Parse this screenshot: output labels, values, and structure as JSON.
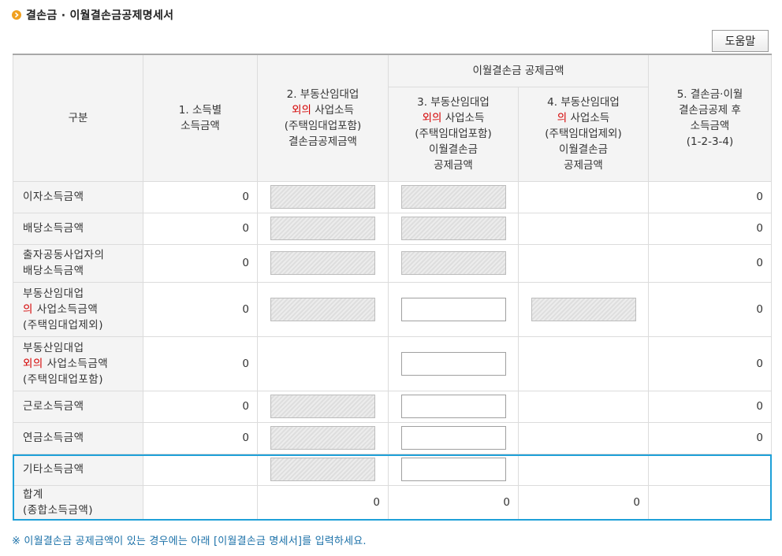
{
  "title": "결손금 · 이월결손금공제명세서",
  "help_button": "도움말",
  "header": {
    "gubun": "구분",
    "c1": [
      "1. 소득별",
      "소득금액"
    ],
    "c2": {
      "l1": "2. 부동산임대업",
      "l2_red": "외의",
      "l2_rest": " 사업소득",
      "l3": "(주택임대업포함)",
      "l4": "결손금공제금액"
    },
    "group": "이월결손금 공제금액",
    "c3": {
      "l1": "3. 부동산임대업",
      "l2_red": "외의",
      "l2_rest": " 사업소득",
      "l3": "(주택임대업포함)",
      "l4": "이월결손금",
      "l5": "공제금액"
    },
    "c4": {
      "l1": "4. 부동산임대업",
      "l2_red": "의",
      "l2_rest": " 사업소득",
      "l3": "(주택임대업제외)",
      "l4": "이월결손금",
      "l5": "공제금액"
    },
    "c5": [
      "5. 결손금·이월",
      "결손금공제 후",
      "소득금액",
      "(1-2-3-4)"
    ]
  },
  "rows": [
    {
      "label": "이자소득금액",
      "c1": "0",
      "c5": "0"
    },
    {
      "label": "배당소득금액",
      "c1": "0",
      "c5": "0"
    },
    {
      "label_l1": "출자공동사업자의",
      "label_l2": "배당소득금액",
      "c1": "0",
      "c5": "0"
    },
    {
      "label_l1": "부동산임대업",
      "label_red": "의",
      "label_rest": " 사업소득금액",
      "label_l3": "(주택임대업제외)",
      "c1": "0",
      "c5": "0"
    },
    {
      "label_l1": "부동산임대업",
      "label_red": "외의",
      "label_rest": " 사업소득금액",
      "label_l3": "(주택임대업포함)",
      "c1": "0",
      "c5": "0"
    },
    {
      "label": "근로소득금액",
      "c1": "0",
      "c5": "0"
    },
    {
      "label": "연금소득금액",
      "c1": "0",
      "c5": "0"
    },
    {
      "label": "기타소득금액"
    }
  ],
  "total": {
    "label_l1": "합계",
    "label_l2": "(종합소득금액)",
    "c2": "0",
    "c3": "0",
    "c4": "0"
  },
  "note": "※ 이월결손금 공제금액이 있는 경우에는 아래 [이월결손금 명세서]를 입력하세요.",
  "colors": {
    "accent_orange": "#f0a020",
    "red_text": "#d40000",
    "highlight_border": "#1ea0d8",
    "note_text": "#1a70a8"
  }
}
